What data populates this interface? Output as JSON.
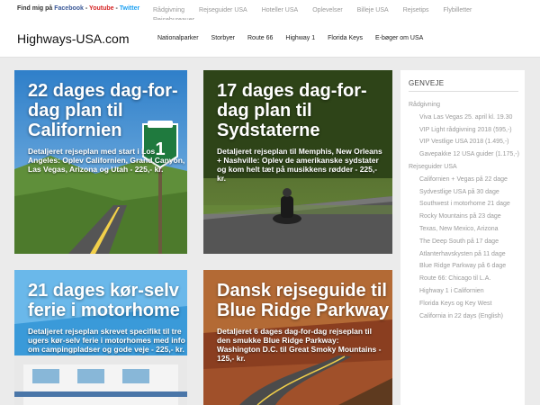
{
  "topbar": {
    "find_text": "Find mig på",
    "facebook": "Facebook",
    "youtube": "Youtube",
    "twitter": "Twitter",
    "sep": "-",
    "links": [
      "Rådgivning",
      "Rejseguider USA",
      "Hoteller USA",
      "Oplevelser",
      "Billeje USA",
      "Rejsetips",
      "Flybilletter",
      "Rejsebureauer"
    ]
  },
  "header": {
    "brand": "Highways-USA.com",
    "nav": [
      "Nationalparker",
      "Storbyer",
      "Route 66",
      "Highway 1",
      "Florida Keys",
      "E-bøger om USA"
    ]
  },
  "cards": [
    {
      "title": "22 dages dag-for-dag plan til Californien",
      "desc": "Detaljeret rejseplan med start i Los Angeles: Oplev Californien, Grand Canyon, Las Vegas, Arizona og Utah - 225,- kr."
    },
    {
      "title": "17 dages dag-for-dag plan til Sydstaterne",
      "desc": "Detaljeret rejseplan til Memphis, New Orleans + Nashville: Oplev de amerikanske sydstater og kom helt tæt på musikkens rødder - 225,- kr."
    },
    {
      "title": "21 dages kør-selv ferie i motorhome",
      "desc": "Detaljeret rejseplan skrevet specifikt til tre ugers kør-selv ferie i motorhomes med info om campingpladser og gode veje - 225,- kr."
    },
    {
      "title": "Dansk rejseguide til Blue Ridge Parkway",
      "desc": "Detaljeret 6 dages dag-for-dag rejseplan til den smukke Blue Ridge Parkway: Washington D.C. til Great Smoky Mountains - 125,- kr."
    }
  ],
  "sidebar": {
    "title": "GENVEJE",
    "items": [
      {
        "text": "Rådgivning",
        "level": "cat"
      },
      {
        "text": "Viva Las Vegas 25. april kl. 19.30",
        "level": "sub"
      },
      {
        "text": "VIP Light rådgivning 2018 (595,-)",
        "level": "sub"
      },
      {
        "text": "VIP Vestlige USA 2018 (1.495,-)",
        "level": "sub"
      },
      {
        "text": "Gavepakke 12 USA guider (1.175,-)",
        "level": "sub"
      },
      {
        "text": "Rejseguider USA",
        "level": "cat"
      },
      {
        "text": "Californien + Vegas på 22 dage",
        "level": "sub"
      },
      {
        "text": "Sydvestlige USA på 30 dage",
        "level": "sub"
      },
      {
        "text": "Southwest i motorhome 21 dage",
        "level": "sub"
      },
      {
        "text": "Rocky Mountains på 23 dage",
        "level": "sub"
      },
      {
        "text": "Texas, New Mexico, Arizona",
        "level": "sub"
      },
      {
        "text": "The Deep South på 17 dage",
        "level": "sub"
      },
      {
        "text": "Atlanterhavskysten på 11 dage",
        "level": "sub"
      },
      {
        "text": "Blue Ridge Parkway på 6 dage",
        "level": "sub"
      },
      {
        "text": "Route 66: Chicago til L.A.",
        "level": "sub"
      },
      {
        "text": "Highway 1 i Californien",
        "level": "sub"
      },
      {
        "text": "Florida Keys og Key West",
        "level": "sub"
      },
      {
        "text": "California in 22 days (English)",
        "level": "sub"
      }
    ]
  },
  "colors": {
    "facebook": "#3b5998",
    "youtube": "#d62424",
    "twitter": "#1da1f2",
    "page_bg": "#ebebeb"
  }
}
